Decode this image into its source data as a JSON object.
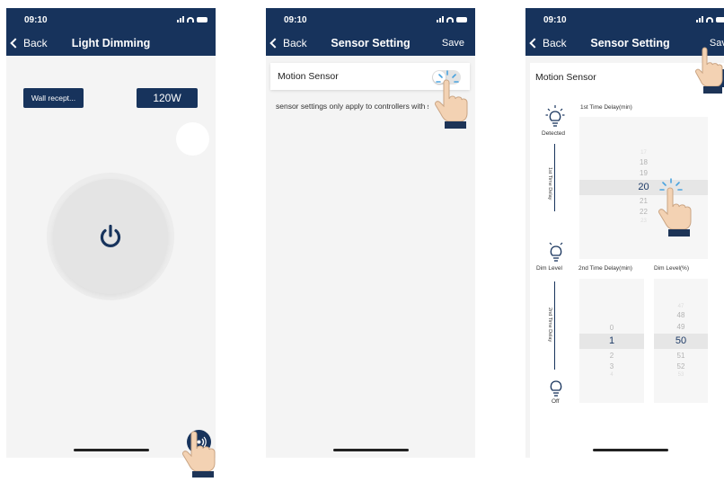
{
  "status": {
    "time": "09:10"
  },
  "screen1": {
    "back_label": "Back",
    "title": "Light Dimming",
    "device_chip": "Wall recept...",
    "power_chip": "120W"
  },
  "screen2": {
    "back_label": "Back",
    "title": "Sensor Setting",
    "save_label": "Save",
    "motion_sensor_label": "Motion Sensor",
    "motion_sensor_on": false,
    "note": "sensor settings only apply to controllers with s"
  },
  "screen3": {
    "back_label": "Back",
    "title": "Sensor Setting",
    "save_label": "Save",
    "motion_sensor_label": "Motion Sensor",
    "motion_sensor_on": true,
    "labels": {
      "detected": "Detected",
      "first_delay_header": "1st Time Delay(min)",
      "first_delay_axis": "1st Time Delay",
      "dim_level": "Dim Level",
      "second_delay_header": "2nd Time Delay(min)",
      "dim_level_header": "Dim Level(%)",
      "second_delay_axis": "2nd Time Delay",
      "off": "Off"
    },
    "picker1": {
      "values": [
        "17",
        "18",
        "19",
        "20",
        "21",
        "22",
        "23"
      ],
      "selected": "20"
    },
    "picker2": {
      "values": [
        "0",
        "1",
        "2",
        "3",
        "4"
      ],
      "selected": "1"
    },
    "picker3": {
      "values": [
        "47",
        "48",
        "49",
        "50",
        "51",
        "52",
        "53"
      ],
      "selected": "50"
    }
  },
  "colors": {
    "nav": "#17335c",
    "accent": "#17335c",
    "tap": "#4aa3df",
    "screen_bg": "#f4f4f4"
  }
}
